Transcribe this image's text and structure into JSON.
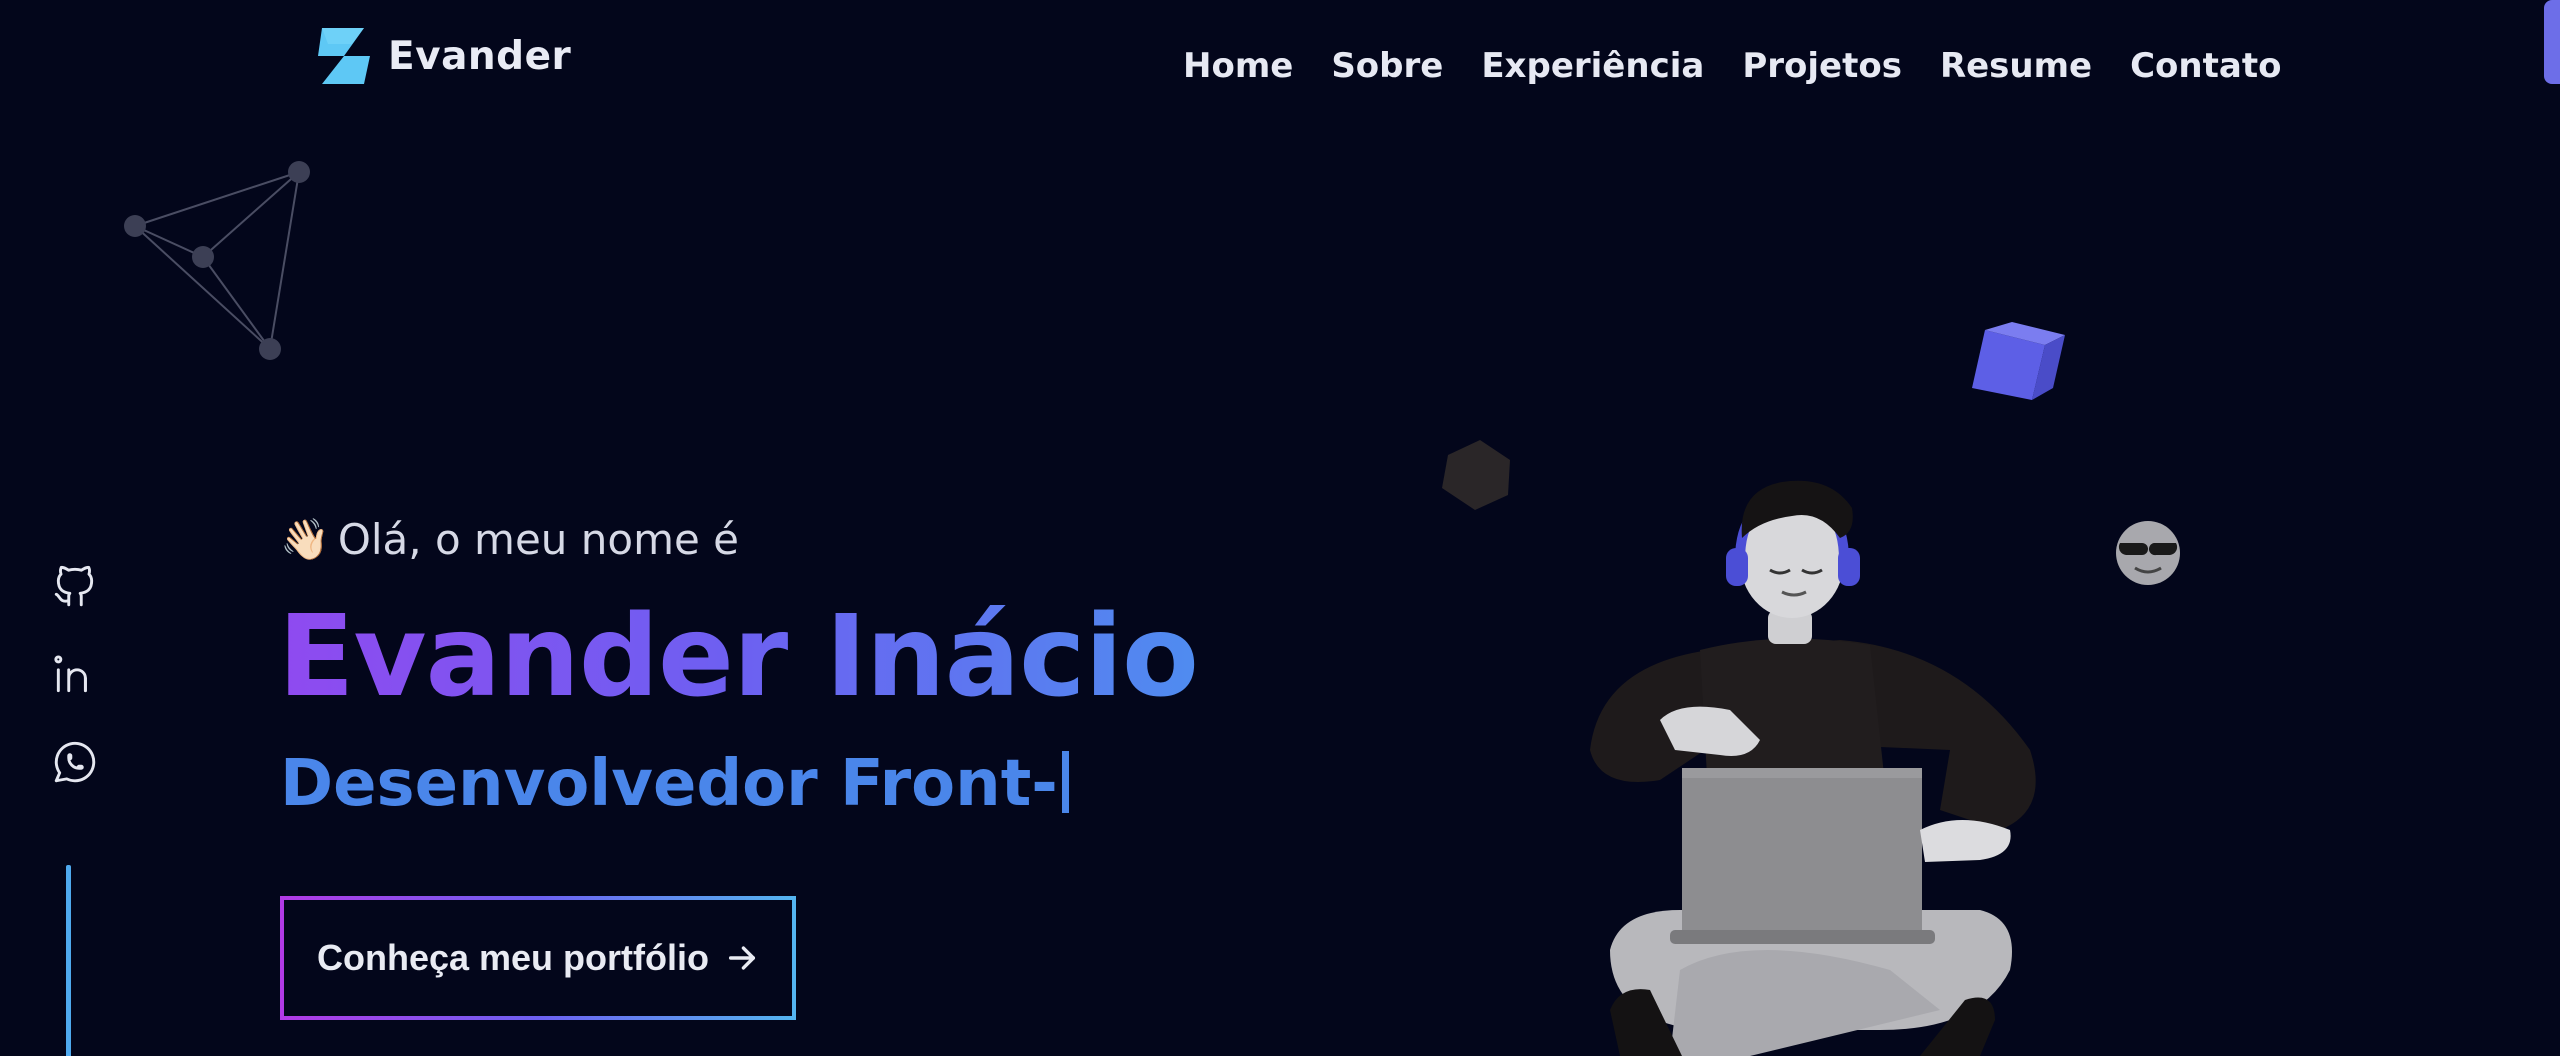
{
  "brand": {
    "name": "Evander",
    "logo_icon": "lightning-bolt-icon",
    "logo_color": "#5ec8f5"
  },
  "nav": {
    "items": [
      {
        "label": "Home"
      },
      {
        "label": "Sobre"
      },
      {
        "label": "Experiência"
      },
      {
        "label": "Projetos"
      },
      {
        "label": "Resume"
      },
      {
        "label": "Contato"
      }
    ]
  },
  "social": {
    "icons": [
      "github-icon",
      "linkedin-icon",
      "whatsapp-icon"
    ]
  },
  "hero": {
    "wave_emoji": "👋🏻",
    "greeting": "Olá, o meu nome é",
    "name": "Evander Inácio",
    "role": "Desenvolvedor Front-",
    "cta_label": "Conheça meu portfólio"
  },
  "colors": {
    "background": "#03061b",
    "accent_purple": "#8f4af0",
    "accent_blue": "#4a86ea",
    "cube": "#5d5fe6",
    "scrollbar": "#6d6ee8"
  }
}
